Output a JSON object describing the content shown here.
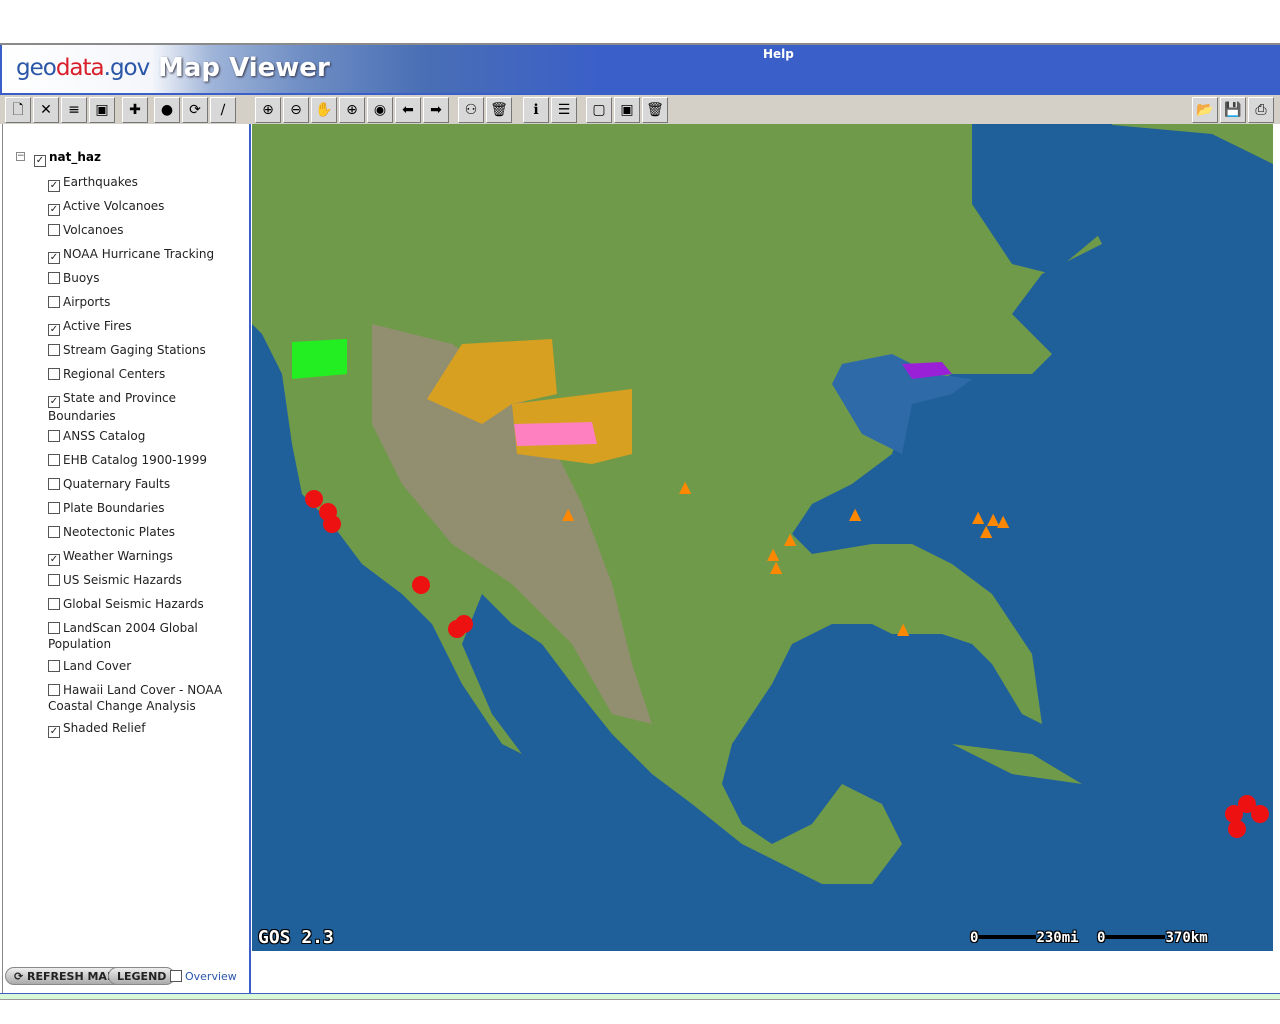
{
  "header": {
    "logo_geo": "geo",
    "logo_data": "data",
    "logo_gov": ".gov",
    "title": "Map Viewer",
    "help": "Help"
  },
  "toolbar": {
    "left": [
      {
        "name": "new-icon",
        "g": "🗋"
      },
      {
        "name": "close-icon",
        "g": "✕"
      },
      {
        "name": "layer-order-icon",
        "g": "≡"
      },
      {
        "name": "layer-properties-icon",
        "g": "▣"
      },
      {
        "name": "add-layer-icon",
        "g": "✚"
      },
      {
        "name": "stop-icon",
        "g": "●"
      },
      {
        "name": "refresh-icon",
        "g": "⟳"
      },
      {
        "name": "tools-icon",
        "g": "∕"
      }
    ],
    "map": [
      {
        "name": "zoom-in-icon",
        "g": "⊕"
      },
      {
        "name": "zoom-out-icon",
        "g": "⊖"
      },
      {
        "name": "pan-hand-icon",
        "g": "✋"
      },
      {
        "name": "zoom-extent-icon",
        "g": "⊕"
      },
      {
        "name": "globe-icon",
        "g": "◉"
      },
      {
        "name": "back-arrow-icon",
        "g": "⬅"
      },
      {
        "name": "forward-arrow-icon",
        "g": "➡"
      },
      {
        "name": "find-binoculars-icon",
        "g": "⚇"
      },
      {
        "name": "clear-trash-icon",
        "g": "🗑"
      },
      {
        "name": "identify-info-icon",
        "g": "ℹ"
      },
      {
        "name": "legend-list-icon",
        "g": "☰"
      },
      {
        "name": "select-rectangle-icon",
        "g": "▢"
      },
      {
        "name": "select-feature-icon",
        "g": "▣"
      },
      {
        "name": "clear-selection-icon",
        "g": "🗑"
      }
    ],
    "right": [
      {
        "name": "open-folder-icon",
        "g": "📂"
      },
      {
        "name": "save-icon",
        "g": "💾"
      },
      {
        "name": "print-icon",
        "g": "⎙"
      }
    ]
  },
  "layers": {
    "group": "nat_haz",
    "group_checked": true,
    "items": [
      {
        "label": "Earthquakes",
        "checked": true
      },
      {
        "label": "Active Volcanoes",
        "checked": true
      },
      {
        "label": "Volcanoes",
        "checked": false
      },
      {
        "label": "NOAA Hurricane Tracking",
        "checked": true
      },
      {
        "label": "Buoys",
        "checked": false
      },
      {
        "label": "Airports",
        "checked": false
      },
      {
        "label": "Active Fires",
        "checked": true
      },
      {
        "label": "Stream Gaging Stations",
        "checked": false
      },
      {
        "label": "Regional Centers",
        "checked": false
      },
      {
        "label": "State and Province Boundaries",
        "checked": true
      },
      {
        "label": "ANSS Catalog",
        "checked": false
      },
      {
        "label": "EHB Catalog 1900-1999",
        "checked": false
      },
      {
        "label": "Quaternary Faults",
        "checked": false
      },
      {
        "label": "Plate Boundaries",
        "checked": false
      },
      {
        "label": "Neotectonic Plates",
        "checked": false
      },
      {
        "label": "Weather Warnings",
        "checked": true
      },
      {
        "label": "US Seismic Hazards",
        "checked": false
      },
      {
        "label": "Global Seismic Hazards",
        "checked": false
      },
      {
        "label": "LandScan 2004 Global Population",
        "checked": false
      },
      {
        "label": "Land Cover",
        "checked": false
      },
      {
        "label": "Hawaii Land Cover - NOAA Coastal Change Analysis",
        "checked": false
      },
      {
        "label": "Shaded Relief",
        "checked": true
      }
    ]
  },
  "footer": {
    "refresh": "REFRESH MAP",
    "legend": "LEGEND",
    "overview": "Overview",
    "overview_checked": false
  },
  "map": {
    "watermark": "GOS 2.3",
    "scale_mi_zero": "0",
    "scale_mi": "230mi",
    "scale_km_zero": "0",
    "scale_km": "370km"
  }
}
